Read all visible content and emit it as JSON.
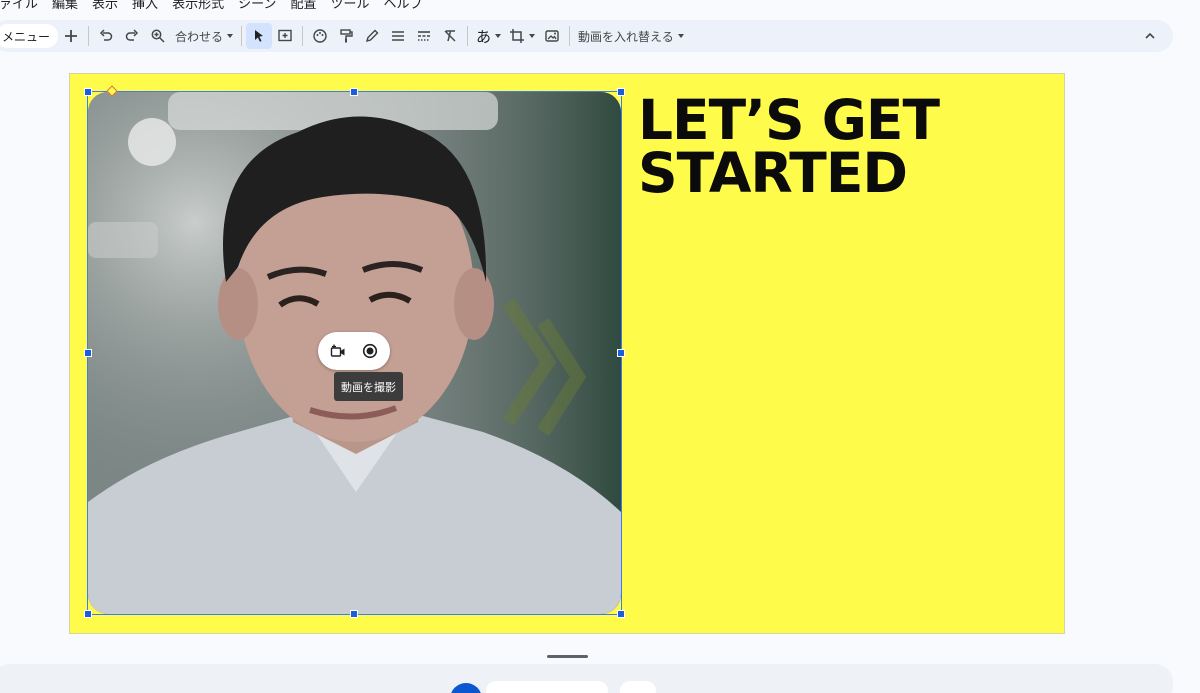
{
  "menu": {
    "items": [
      "ファイル",
      "編集",
      "表示",
      "挿入",
      "表示形式",
      "シーン",
      "配置",
      "ツール",
      "ヘルプ"
    ]
  },
  "toolbar": {
    "menu_label": "メニュー",
    "zoom_label": "合わせる",
    "replace_video_label": "動画を入れ替える"
  },
  "slide": {
    "background": "#fefb4b",
    "headline_line1": "LET’S GET",
    "headline_line2": "STARTED"
  },
  "video_controls": {
    "tooltip": "動画を撮影"
  },
  "colors": {
    "accent": "#0b57d0",
    "selection": "#3d7cf0"
  }
}
